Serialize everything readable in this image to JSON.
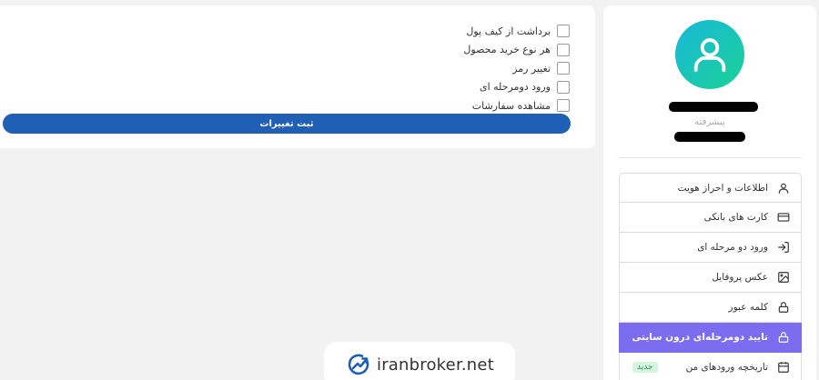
{
  "permissions": [
    {
      "label": "برداشت از کیف پول",
      "checked": false
    },
    {
      "label": "هر نوع خرید محصول",
      "checked": false
    },
    {
      "label": "تغییر رمز",
      "checked": false
    },
    {
      "label": "ورود دومرحله ای",
      "checked": false
    },
    {
      "label": "مشاهده سفارشات",
      "checked": false
    }
  ],
  "submit_label": "ثبت تغییرات",
  "profile": {
    "level": "پیشرفته"
  },
  "menu": [
    {
      "label": "اطلاعات و احراز هویت",
      "icon": "user-icon"
    },
    {
      "label": "کارت های بانکی",
      "icon": "credit-card-icon"
    },
    {
      "label": "ورود دو مرحله ای",
      "icon": "login-icon"
    },
    {
      "label": "عکس پروفایل",
      "icon": "image-icon"
    },
    {
      "label": "کلمه عبور",
      "icon": "lock-icon"
    },
    {
      "label": "تایید دومرحله‌ای درون سایتی",
      "icon": "lock-icon",
      "active": true
    },
    {
      "label": "تاریخچه ورودهای من",
      "icon": "calendar-icon",
      "badge": "جدید"
    }
  ],
  "logo": {
    "text": "iranbroker.net"
  },
  "colors": {
    "primary_button": "#1f5fb6",
    "active_menu": "#7b6cf0",
    "avatar_from": "#19b8d8",
    "avatar_to": "#1ad296"
  }
}
